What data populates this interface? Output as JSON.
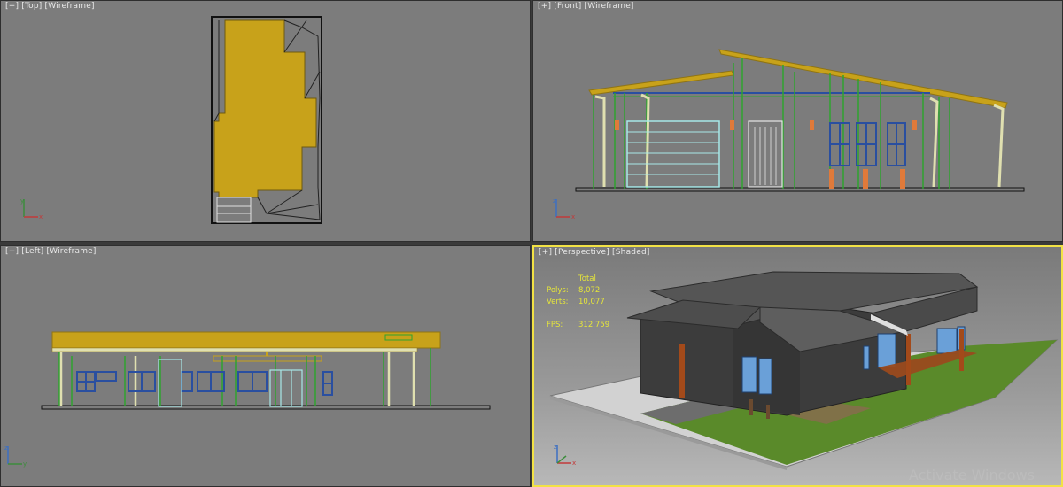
{
  "viewports": {
    "top": {
      "plus": "[+]",
      "view": "[Top]",
      "mode": "[Wireframe]"
    },
    "front": {
      "plus": "[+]",
      "view": "[Front]",
      "mode": "[Wireframe]"
    },
    "left": {
      "plus": "[+]",
      "view": "[Left]",
      "mode": "[Wireframe]"
    },
    "persp": {
      "plus": "[+]",
      "view": "[Perspective]",
      "mode": "[Shaded]"
    }
  },
  "stats": {
    "header": "Total",
    "polys_label": "Polys:",
    "polys_value": "8,072",
    "verts_label": "Verts:",
    "verts_value": "10,077",
    "fps_label": "FPS:",
    "fps_value": "312.759"
  },
  "axes": {
    "x": "x",
    "y": "y",
    "z": "z"
  },
  "watermark": "Activate Windows",
  "colors": {
    "viewport_bg": "#7c7c7c",
    "active_border": "#f2e245",
    "roof_yellow": "#c8a21a",
    "wire_green": "#2fa32f",
    "wire_blue": "#2a4fa0",
    "stats_yellow": "#e6e63a"
  }
}
